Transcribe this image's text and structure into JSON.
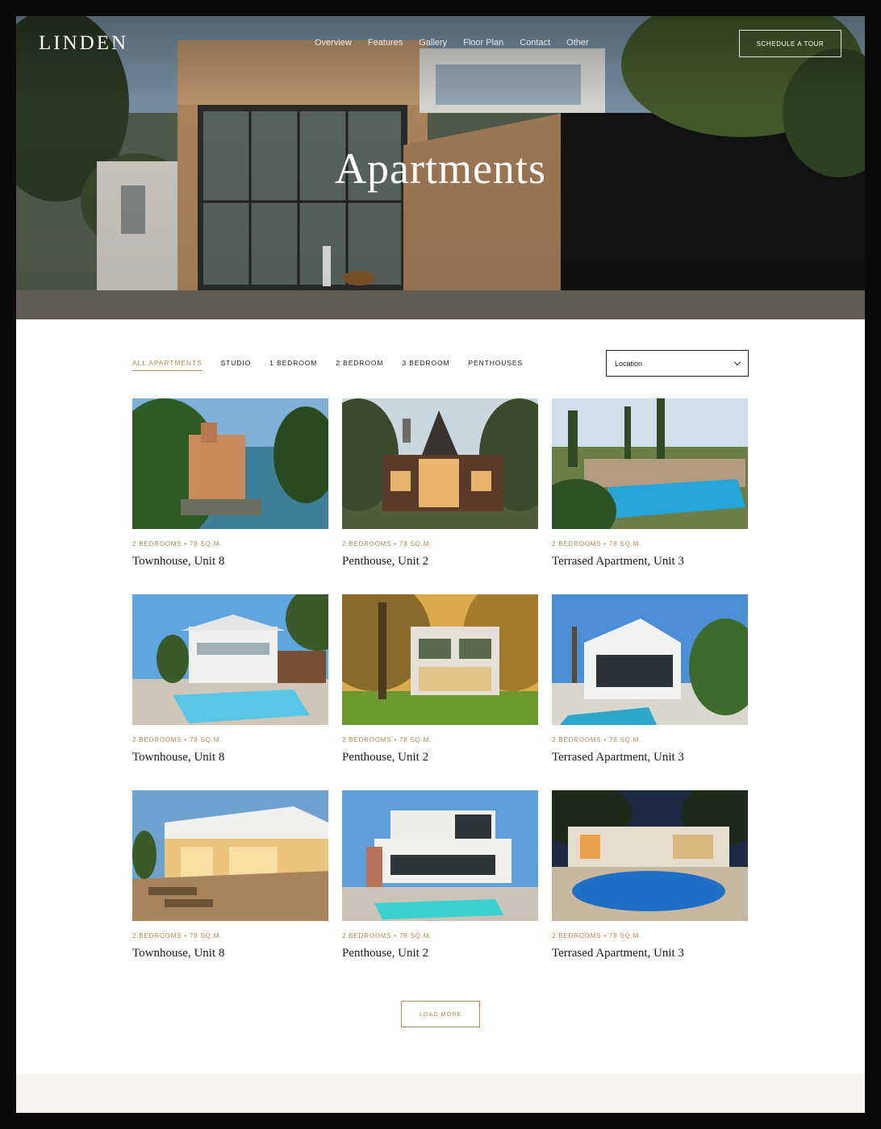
{
  "header": {
    "logo": "LINDEN",
    "nav": [
      "Overview",
      "Features",
      "Gallery",
      "Floor Plan",
      "Contact",
      "Other"
    ],
    "cta": "SCHEDULE A TOUR"
  },
  "hero": {
    "title": "Apartments"
  },
  "filters": {
    "tabs": [
      "ALL APARTMENTS",
      "STUDIO",
      "1 BEDROOM",
      "2 BEDROOM",
      "3 BEDROOM",
      "PENTHOUSES"
    ],
    "active_index": 0,
    "location_placeholder": "Location"
  },
  "listings": [
    {
      "meta": "2 BEDROOMS • 78 SQ.M.",
      "title": "Townhouse, Unit 8"
    },
    {
      "meta": "2 BEDROOMS • 78 SQ.M.",
      "title": "Penthouse, Unit 2"
    },
    {
      "meta": "2 BEDROOMS • 78 SQ.M.",
      "title": "Terrased Apartment, Unit 3"
    },
    {
      "meta": "2 BEDROOMS • 78 SQ.M.",
      "title": "Townhouse, Unit 8"
    },
    {
      "meta": "2 BEDROOMS • 78 SQ.M.",
      "title": "Penthouse, Unit 2"
    },
    {
      "meta": "2 BEDROOMS • 78 SQ.M.",
      "title": "Terrased Apartment, Unit 3"
    },
    {
      "meta": "2 BEDROOMS • 78 SQ.M.",
      "title": "Townhouse, Unit 8"
    },
    {
      "meta": "2 BEDROOMS • 78 SQ.M.",
      "title": "Penthouse, Unit 2"
    },
    {
      "meta": "2 BEDROOMS • 78 SQ.M.",
      "title": "Terrased Apartment, Unit 3"
    }
  ],
  "load_more": "LOAD MORE",
  "colors": {
    "accent": "#b48a55",
    "text": "#1b1b1b",
    "footer": "#f6f3ef"
  }
}
